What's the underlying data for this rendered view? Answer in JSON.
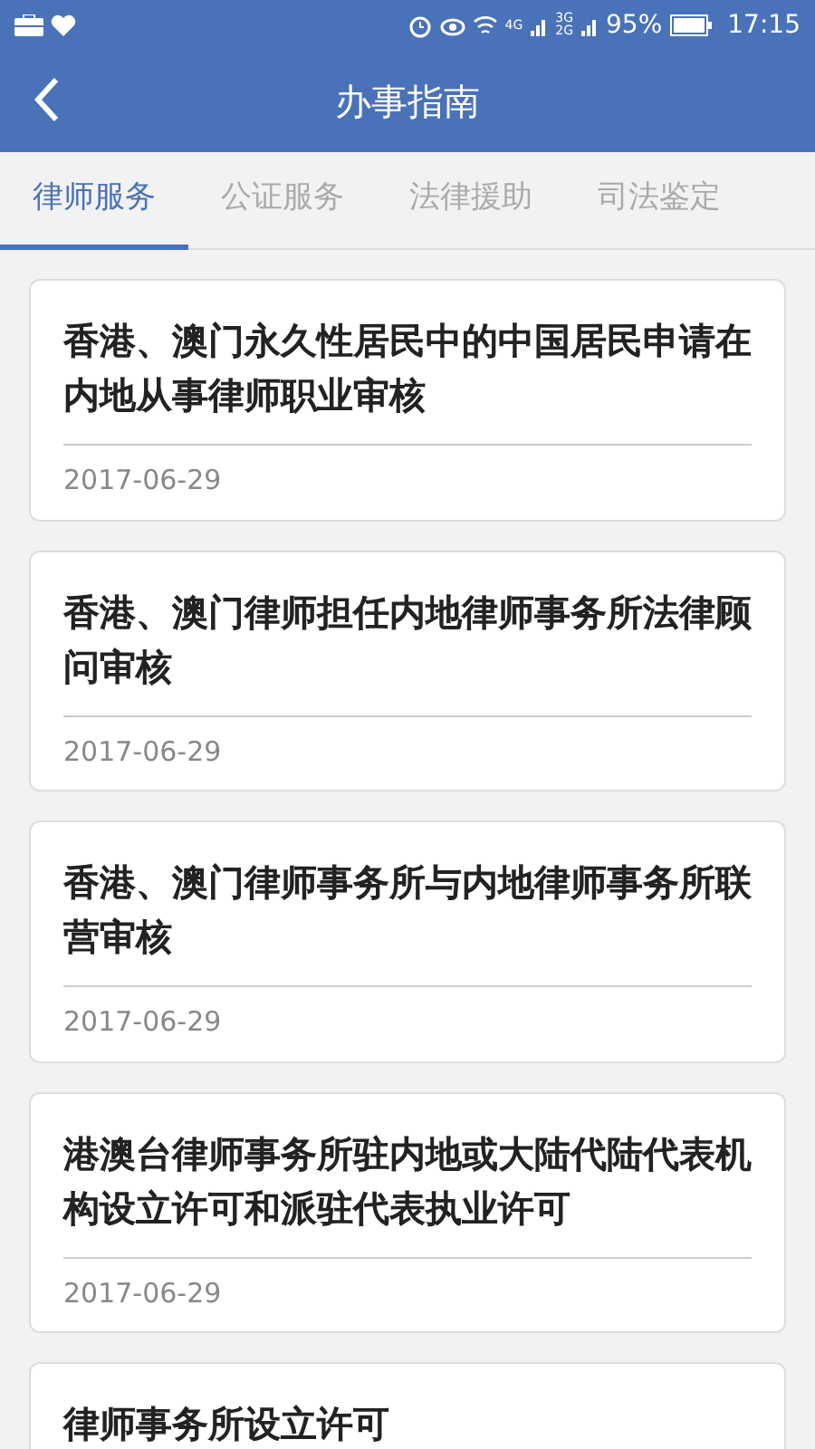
{
  "status_bar": {
    "network_4g": "4G",
    "network_3g": "3G",
    "network_2g": "2G",
    "battery": "95%",
    "time": "17:15"
  },
  "header": {
    "title": "办事指南"
  },
  "tabs": [
    {
      "label": "律师服务",
      "selected": true
    },
    {
      "label": "公证服务",
      "selected": false
    },
    {
      "label": "法律援助",
      "selected": false
    },
    {
      "label": "司法鉴定",
      "selected": false
    }
  ],
  "items": [
    {
      "title": "香港、澳门永久性居民中的中国居民申请在内地从事律师职业审核",
      "date": "2017-06-29"
    },
    {
      "title": "香港、澳门律师担任内地律师事务所法律顾问审核",
      "date": "2017-06-29"
    },
    {
      "title": "香港、澳门律师事务所与内地律师事务所联营审核",
      "date": "2017-06-29"
    },
    {
      "title": "港澳台律师事务所驻内地或大陆代陆代表机构设立许可和派驻代表执业许可",
      "date": "2017-06-29"
    },
    {
      "title": "律师事务所设立许可"
    }
  ]
}
